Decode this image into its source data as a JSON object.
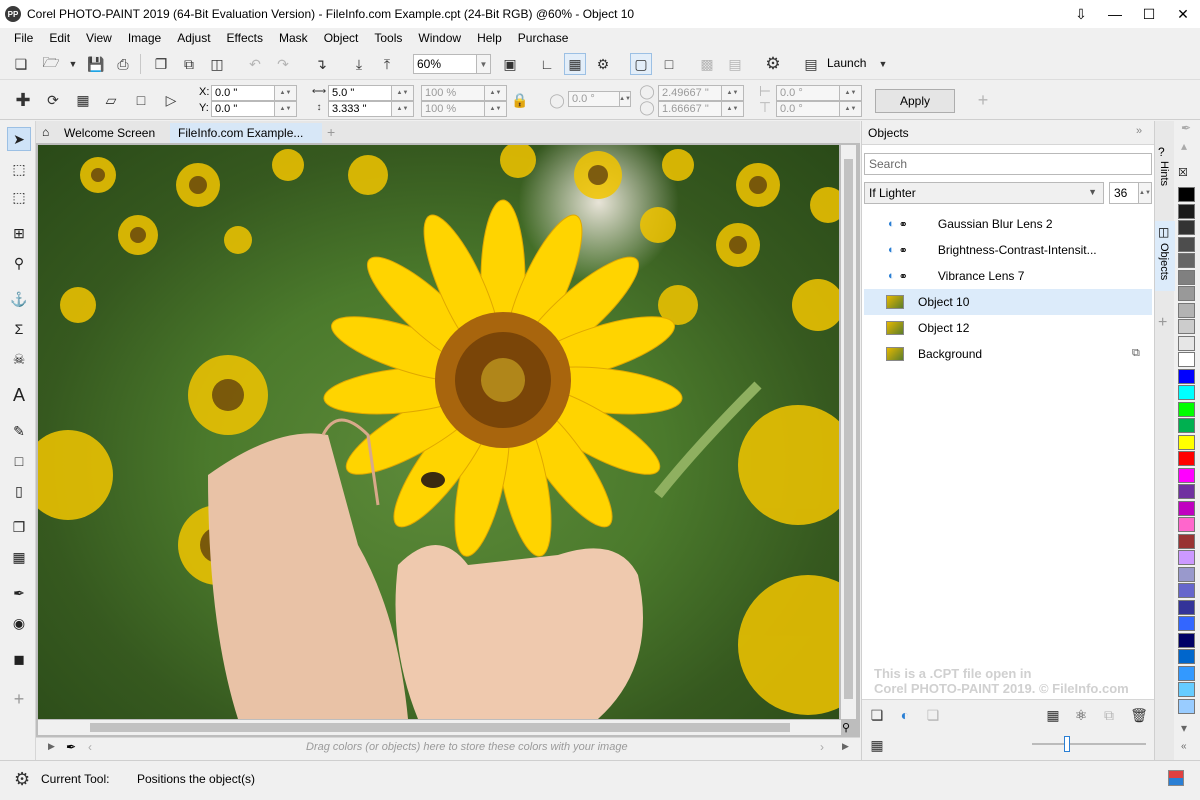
{
  "window": {
    "title": "Corel PHOTO-PAINT 2019 (64-Bit Evaluation Version) - FileInfo.com Example.cpt (24-Bit RGB) @60% - Object 10",
    "logo": "PP"
  },
  "menu": [
    "File",
    "Edit",
    "View",
    "Image",
    "Adjust",
    "Effects",
    "Mask",
    "Object",
    "Tools",
    "Window",
    "Help",
    "Purchase"
  ],
  "toolbar": {
    "zoom_value": "60%",
    "launch_label": "Launch"
  },
  "property_bar": {
    "x_label": "X:",
    "x_value": "0.0 \"",
    "y_label": "Y:",
    "y_value": "0.0 \"",
    "width_value": "5.0 \"",
    "height_value": "3.333 \"",
    "scale_w": "100 %",
    "scale_h": "100 %",
    "rotation": "0.0 °",
    "center_x": "2.49667 \"",
    "center_y": "1.66667 \"",
    "skew_h": "0.0 °",
    "skew_v": "0.0 °",
    "apply_label": "Apply"
  },
  "tabs": {
    "welcome": "Welcome Screen",
    "document": "FileInfo.com Example..."
  },
  "color_tray": {
    "hint": "Drag colors (or objects) here to store these colors with your image"
  },
  "objects_docker": {
    "title": "Objects",
    "search_placeholder": "Search",
    "blend_mode": "If Lighter",
    "opacity": "36",
    "layers": [
      {
        "name": "Gaussian Blur Lens 2",
        "kind": "lens"
      },
      {
        "name": "Brightness-Contrast-Intensit...",
        "kind": "lens"
      },
      {
        "name": "Vibrance Lens 7",
        "kind": "lens"
      },
      {
        "name": "Object 10",
        "kind": "object",
        "selected": true
      },
      {
        "name": "Object 12",
        "kind": "object"
      },
      {
        "name": "Background",
        "kind": "background"
      }
    ],
    "watermark_line1": "This is a .CPT file open in",
    "watermark_line2": "Corel PHOTO-PAINT 2019. © FileInfo.com"
  },
  "side_tabs": {
    "hints": "Hints",
    "objects": "Objects"
  },
  "palette": [
    "#000000",
    "#1a1a1a",
    "#333333",
    "#4d4d4d",
    "#666666",
    "#808080",
    "#999999",
    "#b3b3b3",
    "#cccccc",
    "#e6e6e6",
    "#ffffff",
    "#0000ff",
    "#00ffff",
    "#00ff00",
    "#00b050",
    "#ffff00",
    "#ff0000",
    "#ff00ff",
    "#7030a0",
    "#c000c0",
    "#ff66cc",
    "#993333",
    "#cc99ff",
    "#9999cc",
    "#6666cc",
    "#333399",
    "#3366ff",
    "#000066",
    "#0066cc",
    "#3399ff",
    "#66ccff",
    "#99ccff"
  ],
  "status": {
    "current_tool_label": "Current Tool:",
    "current_tool_desc": "Positions the object(s)"
  }
}
